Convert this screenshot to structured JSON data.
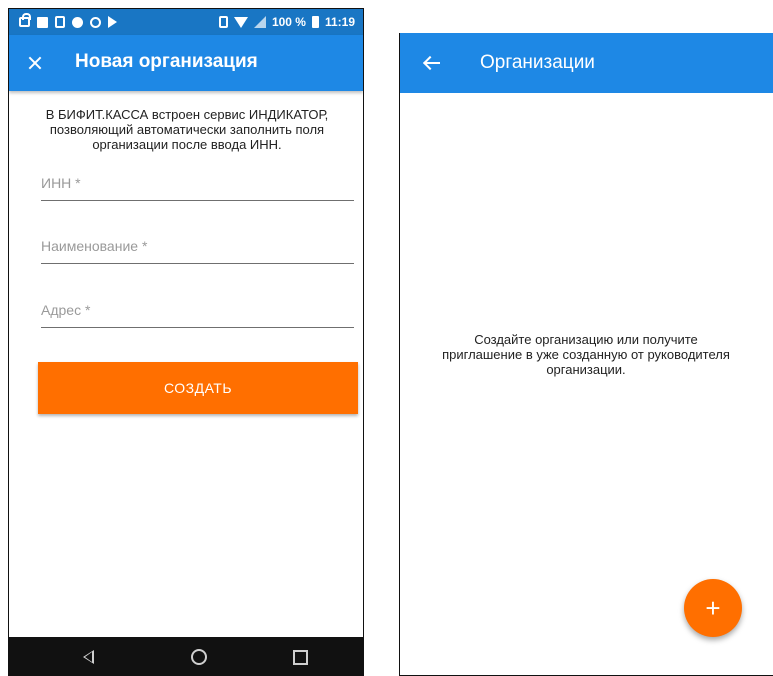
{
  "left_screen": {
    "statusbar": {
      "battery": "100 %",
      "time": "11:19"
    },
    "appbar": {
      "title": "Новая организация",
      "close_icon": "close-icon"
    },
    "intro_text": "В БИФИТ.КАССА встроен сервис ИНДИКАТОР, позволяющий автоматически заполнить поля организации после ввода ИНН.",
    "fields": {
      "inn_placeholder": "ИНН *",
      "name_placeholder": "Наименование *",
      "address_placeholder": "Адрес *"
    },
    "create_button": "СОЗДАТЬ",
    "navbar": {
      "back": "nav-back-icon",
      "home": "nav-home-icon",
      "recent": "nav-recent-icon"
    }
  },
  "right_screen": {
    "appbar": {
      "title": "Организации",
      "back_icon": "arrow-left-icon"
    },
    "empty_message": "Создайте организацию или получите приглашение в уже созданную от руководителя организации.",
    "fab_label": "+"
  },
  "colors": {
    "statusbar": "#1976c4",
    "appbar": "#1e88e5",
    "accent": "#ff6f00",
    "navbar": "#111111"
  }
}
